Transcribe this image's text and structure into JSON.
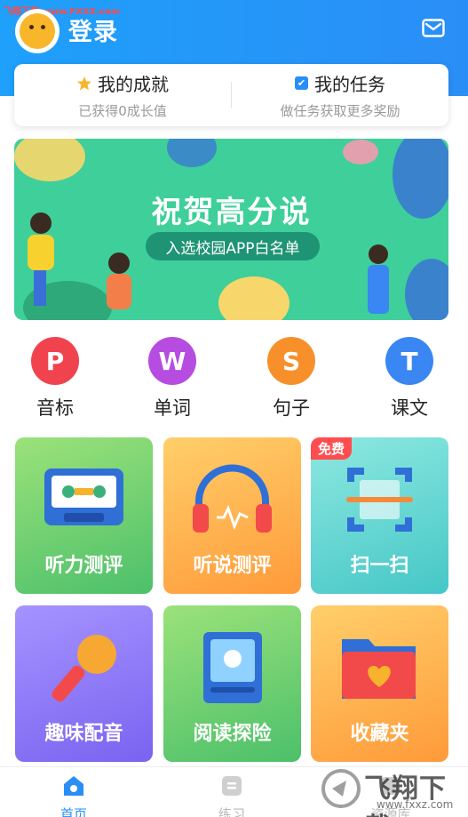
{
  "watermark_top": "飞翔下载 www.FXXZ.com",
  "header": {
    "title": "登录"
  },
  "achievements": {
    "left": {
      "title": "我的成就",
      "subtitle": "已获得0成长值"
    },
    "right": {
      "title": "我的任务",
      "subtitle": "做任务获取更多奖励"
    }
  },
  "banner": {
    "title": "祝贺高分说",
    "pill": "入选校园APP白名单"
  },
  "categories": [
    {
      "letter": "P",
      "label": "音标",
      "color": "#f0434d"
    },
    {
      "letter": "W",
      "label": "单词",
      "color": "#b64ce0"
    },
    {
      "letter": "S",
      "label": "句子",
      "color": "#f7902a"
    },
    {
      "letter": "T",
      "label": "课文",
      "color": "#3a86f2"
    }
  ],
  "tiles": [
    {
      "label": "听力测评",
      "icon": "cassette-icon"
    },
    {
      "label": "听说测评",
      "icon": "headphones-icon"
    },
    {
      "label": "扫一扫",
      "icon": "scan-icon",
      "badge": "免费"
    },
    {
      "label": "趣味配音",
      "icon": "microphone-icon"
    },
    {
      "label": "阅读探险",
      "icon": "book-icon"
    },
    {
      "label": "收藏夹",
      "icon": "folder-heart-icon"
    }
  ],
  "tabbar": [
    {
      "label": "首页",
      "icon": "home-icon",
      "active": true
    },
    {
      "label": "练习",
      "icon": "practice-icon",
      "active": false
    },
    {
      "label": "资源库",
      "icon": "library-icon",
      "active": false
    }
  ],
  "brand_watermark": {
    "text": "飞翔下载",
    "url": "www.fxxz.com"
  },
  "colors": {
    "primary": "#2a8ef7",
    "accent_free": "#ff4d4f"
  }
}
